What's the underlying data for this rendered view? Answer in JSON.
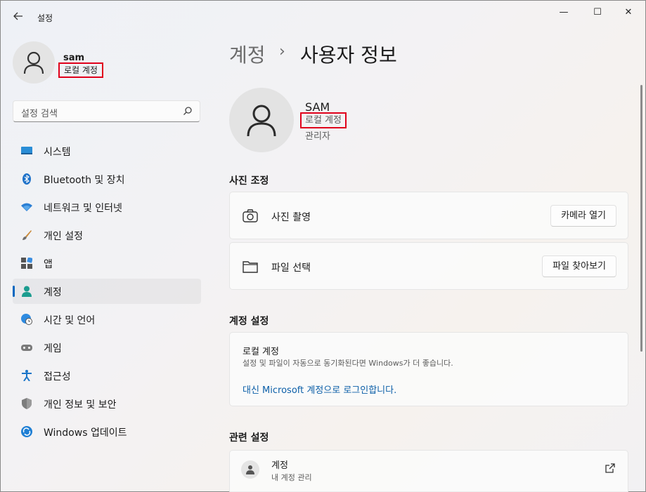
{
  "window": {
    "title": "설정",
    "back_icon": "back-arrow-icon",
    "minimize_glyph": "—",
    "maximize_glyph": "☐",
    "close_glyph": "✕"
  },
  "sidebar": {
    "user_name": "sam",
    "user_type": "로컬 계정",
    "search_placeholder": "설정 검색",
    "items": [
      {
        "label": "시스템",
        "icon": "system-icon"
      },
      {
        "label": "Bluetooth 및 장치",
        "icon": "bluetooth-icon"
      },
      {
        "label": "네트워크 및 인터넷",
        "icon": "network-icon"
      },
      {
        "label": "개인 설정",
        "icon": "personalization-icon"
      },
      {
        "label": "앱",
        "icon": "apps-icon"
      },
      {
        "label": "계정",
        "icon": "accounts-icon",
        "active": true
      },
      {
        "label": "시간 및 언어",
        "icon": "time-language-icon"
      },
      {
        "label": "게임",
        "icon": "gaming-icon"
      },
      {
        "label": "접근성",
        "icon": "accessibility-icon"
      },
      {
        "label": "개인 정보 및 보안",
        "icon": "privacy-shield-icon"
      },
      {
        "label": "Windows 업데이트",
        "icon": "windows-update-icon"
      }
    ]
  },
  "main": {
    "breadcrumb": {
      "parent": "계정",
      "separator": "›",
      "current": "사용자 정보"
    },
    "user": {
      "name": "SAM",
      "type": "로컬 계정",
      "role": "관리자"
    },
    "photo_section": {
      "title": "사진 조정",
      "rows": [
        {
          "label": "사진 촬영",
          "button": "카메라 열기",
          "icon": "camera-icon"
        },
        {
          "label": "파일 선택",
          "button": "파일 찾아보기",
          "icon": "folder-icon"
        }
      ]
    },
    "account_section": {
      "title": "계정 설정",
      "card_title": "로컬 계정",
      "card_desc": "설정 및 파일이 자동으로 동기화된다면 Windows가 더 좋습니다.",
      "link": "대신 Microsoft 계정으로 로그인합니다."
    },
    "related_section": {
      "title": "관련 설정",
      "item_title": "계정",
      "item_sub": "내 계정 관리"
    }
  },
  "colors": {
    "accent": "#0067c0",
    "highlight_box": "#e0001b",
    "link": "#0c5fa8"
  }
}
